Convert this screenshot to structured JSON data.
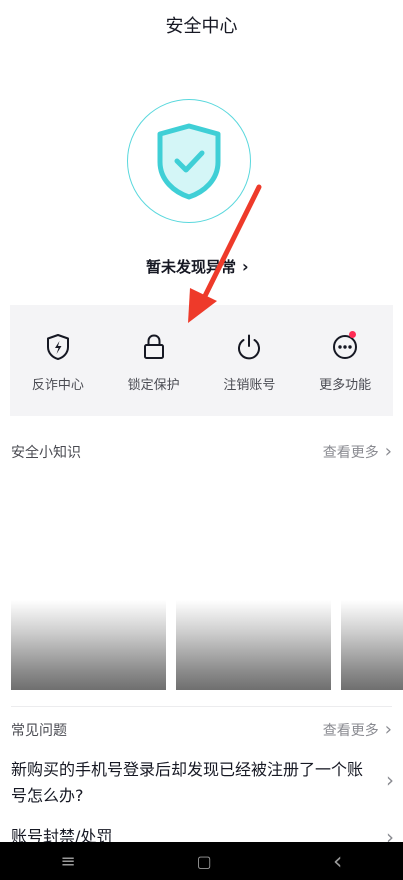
{
  "header": {
    "title": "安全中心"
  },
  "status": {
    "text": "暂未发现异常",
    "chevron": "›"
  },
  "actions": [
    {
      "label": "反诈中心",
      "icon": "shield-bolt-icon"
    },
    {
      "label": "锁定保护",
      "icon": "lock-icon"
    },
    {
      "label": "注销账号",
      "icon": "power-icon"
    },
    {
      "label": "更多功能",
      "icon": "more-dots-icon",
      "badge": true
    }
  ],
  "knowledge": {
    "title": "安全小知识",
    "more_label": "查看更多"
  },
  "faq": {
    "title": "常见问题",
    "more_label": "查看更多",
    "items": [
      {
        "text": "新购买的手机号登录后却发现已经被注册了一个账号怎么办?"
      },
      {
        "text": "账号封禁/处罚"
      }
    ]
  },
  "colors": {
    "accent": "#5ad8dd",
    "arrow": "#ee3a2a",
    "badge": "#fe2c55"
  },
  "nav": {
    "menu": "≡",
    "home": "▢",
    "back": "‹"
  }
}
